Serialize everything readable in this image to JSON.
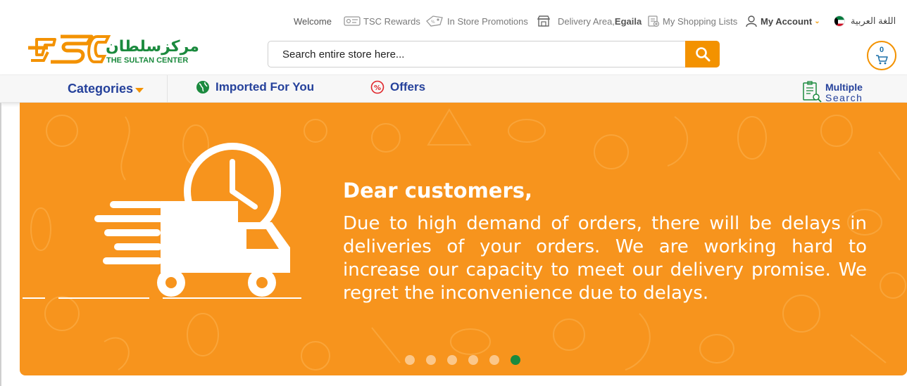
{
  "topbar": {
    "welcome": "Welcome",
    "rewards": "TSC Rewards",
    "promotions": "In Store Promotions",
    "delivery_label": "Delivery Area,",
    "delivery_area": "Egaila",
    "shopping_lists": "My Shopping Lists",
    "my_account": "My Account",
    "language": "اللغة العربية"
  },
  "logo": {
    "arabic": "مركزسلطان",
    "english": "THE SULTAN CENTER"
  },
  "search": {
    "placeholder": "Search entire store here..."
  },
  "cart": {
    "count": "0"
  },
  "nav": {
    "categories": "Categories",
    "imported": "Imported For You",
    "offers": "Offers",
    "multiple": "Multiple",
    "search": "Search"
  },
  "banner": {
    "title": "Dear customers,",
    "body": "Due to high demand of orders, there will be delays in deliveries of your orders. We are working hard to increase our capacity to meet our delivery promise. We regret the inconvenience due to delays.",
    "slide_count": 6,
    "active_slide": 6
  },
  "colors": {
    "brand_orange": "#f39200",
    "banner_orange": "#f7941d",
    "brand_green": "#1b8a3e",
    "nav_blue": "#25419b"
  },
  "icons": {
    "rewards": "card-icon",
    "promotions": "tag-icon",
    "delivery": "store-icon",
    "lists": "list-icon",
    "account": "user-icon",
    "flag": "kuwait-flag-icon",
    "search": "search-icon",
    "cart": "cart-icon",
    "imported": "globe-icon",
    "offers": "percent-icon",
    "multiple_search": "checklist-search-icon"
  }
}
